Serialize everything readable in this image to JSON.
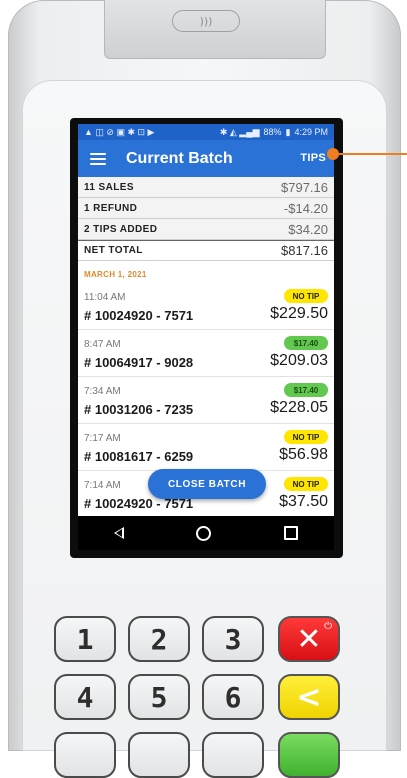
{
  "device": {
    "nfc_logo": ")))"
  },
  "status_bar": {
    "icons_left": "▲ ◫ ⊘ ▣ ✱ ⊡ ▶",
    "battery": "88%",
    "time": "4:29 PM"
  },
  "app_bar": {
    "title": "Current Batch",
    "tips_label": "TIPS"
  },
  "summary": [
    {
      "label": "11 SALES",
      "value": "$797.16"
    },
    {
      "label": "1 REFUND",
      "value": "-$14.20"
    },
    {
      "label": "2 TIPS ADDED",
      "value": "$34.20"
    },
    {
      "label": "NET TOTAL",
      "value": "$817.16"
    }
  ],
  "date_header": "MARCH 1, 2021",
  "transactions": [
    {
      "time": "11:04 AM",
      "id": "# 10024920 - 7571",
      "badge": "NO TIP",
      "amount": "$229.50"
    },
    {
      "time": "8:47 AM",
      "id": "# 10064917 - 9028",
      "badge": "$17.40",
      "amount": "$209.03"
    },
    {
      "time": "7:34 AM",
      "id": "# 10031206 - 7235",
      "badge": "$17.40",
      "amount": "$228.05"
    },
    {
      "time": "7:17 AM",
      "id": "# 10081617 - 6259",
      "badge": "NO TIP",
      "amount": "$56.98"
    },
    {
      "time": "7:14 AM",
      "id": "# 10024920 - 7571",
      "badge": "NO TIP",
      "amount": "$37.50"
    }
  ],
  "close_batch_label": "CLOSE BATCH",
  "keypad": {
    "k1": "1",
    "k2": "2",
    "k3": "3",
    "cancel": "✕",
    "k4": "4",
    "k5": "5",
    "k6": "6",
    "clear": "<"
  },
  "colors": {
    "app_bar": "#2a72d6",
    "no_tip": "#ffe600",
    "tip": "#62c84f",
    "date": "#e08a2c",
    "callout": "#ef7d22"
  }
}
